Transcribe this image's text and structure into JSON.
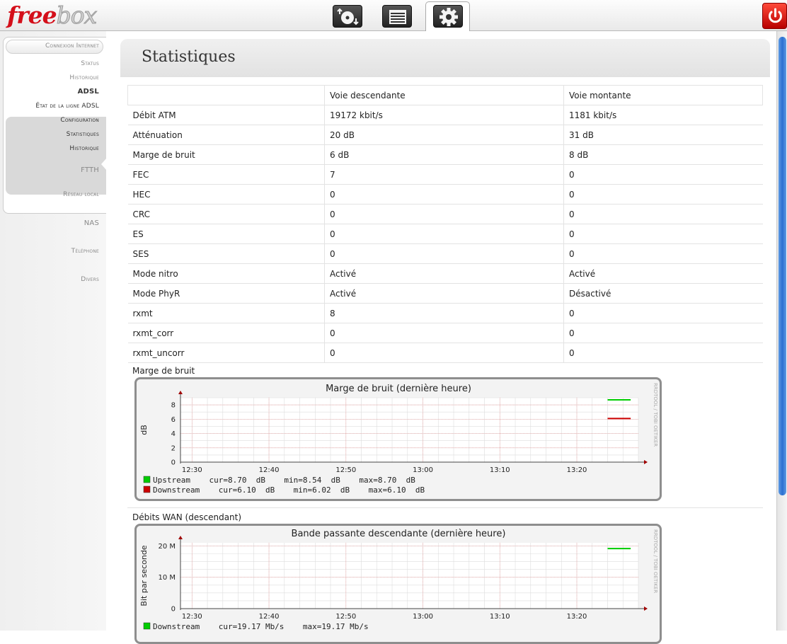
{
  "app": {
    "logo_red": "free",
    "logo_grey": "box"
  },
  "toolbar": {
    "icons": [
      "download-icon",
      "list-icon",
      "gear-icon",
      "power-icon"
    ]
  },
  "sidebar": {
    "connexion": "Connexion Internet",
    "status": "Status",
    "historique": "Historique",
    "adsl": "ADSL",
    "etat": "État de la ligne ADSL",
    "configuration": "Configuration",
    "statistiques": "Statistiques",
    "historique2": "Historique",
    "ftth": "FTTH",
    "reseau": "Réseau local",
    "nas": "NAS",
    "telephone": "Téléphone",
    "divers": "Divers"
  },
  "page": {
    "title": "Statistiques"
  },
  "stats_table": {
    "headers": [
      "",
      "Voie descendante",
      "Voie montante"
    ],
    "rows": [
      [
        "Débit ATM",
        "19172 kbit/s",
        "1181 kbit/s"
      ],
      [
        "Atténuation",
        "20 dB",
        "31 dB"
      ],
      [
        "Marge de bruit",
        "6 dB",
        "8 dB"
      ],
      [
        "FEC",
        "7",
        "0"
      ],
      [
        "HEC",
        "0",
        "0"
      ],
      [
        "CRC",
        "0",
        "0"
      ],
      [
        "ES",
        "0",
        "0"
      ],
      [
        "SES",
        "0",
        "0"
      ],
      [
        "Mode nitro",
        "Activé",
        "Activé"
      ],
      [
        "Mode PhyR",
        "Activé",
        "Désactivé"
      ],
      [
        "rxmt",
        "8",
        "0"
      ],
      [
        "rxmt_corr",
        "0",
        "0"
      ],
      [
        "rxmt_uncorr",
        "0",
        "0"
      ]
    ]
  },
  "graph1": {
    "section_label": "Marge de bruit",
    "watermark": "RRDTOOL / TOBI OETIKER"
  },
  "graph2": {
    "section_label": "Débits WAN (descendant)",
    "watermark": "RRDTOOL / TOBI OETIKER"
  },
  "chart_data": [
    {
      "type": "line",
      "title": "Marge de bruit (dernière heure)",
      "ylabel": "dB",
      "ylim": [
        0,
        9
      ],
      "yticks": [
        "0",
        "2",
        "4",
        "6",
        "8"
      ],
      "xticks": [
        "12:30",
        "12:40",
        "12:50",
        "13:00",
        "13:10",
        "13:20"
      ],
      "series": [
        {
          "name": "Upstream",
          "color": "#00cc00",
          "x": [
            "13:24",
            "13:27"
          ],
          "values": [
            8.7,
            8.7
          ],
          "legend": "Upstream    cur=8.70  dB    min=8.54  dB    max=8.70  dB"
        },
        {
          "name": "Downstream",
          "color": "#cc0000",
          "x": [
            "13:24",
            "13:27"
          ],
          "values": [
            6.1,
            6.1
          ],
          "legend": "Downstream    cur=6.10  dB    min=6.02  dB    max=6.10  dB"
        }
      ]
    },
    {
      "type": "line",
      "title": "Bande passante descendante (dernière heure)",
      "ylabel": "Bit par seconde",
      "ylim": [
        0,
        21000000
      ],
      "yticks": [
        "0",
        "10 M",
        "20 M"
      ],
      "xticks": [
        "12:30",
        "12:40",
        "12:50",
        "13:00",
        "13:10",
        "13:20"
      ],
      "series": [
        {
          "name": "Downstream",
          "color": "#00cc00",
          "x": [
            "13:24",
            "13:27"
          ],
          "values": [
            19170000,
            19170000
          ],
          "legend": "Downstream    cur=19.17 Mb/s    max=19.17 Mb/s"
        }
      ]
    }
  ]
}
